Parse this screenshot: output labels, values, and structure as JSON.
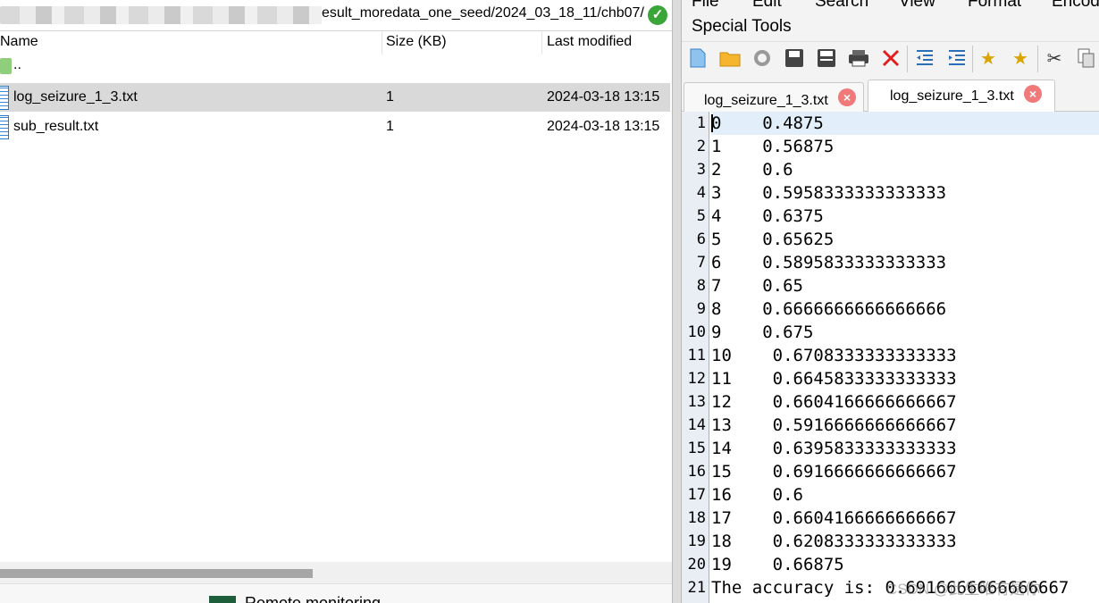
{
  "file_browser": {
    "path": "esult_moredata_one_seed/2024_03_18_11/chb07/",
    "columns": {
      "name": "Name",
      "size": "Size (KB)",
      "modified": "Last modified"
    },
    "parent_label": "..",
    "files": [
      {
        "name": "log_seizure_1_3.txt",
        "size": "1",
        "modified": "2024-03-18 13:15"
      },
      {
        "name": "sub_result.txt",
        "size": "1",
        "modified": "2024-03-18 13:15"
      }
    ],
    "status_text": "Remote monitoring",
    "colors": {
      "selected_row": "#d9d9d9",
      "ok": "#3aa63a"
    }
  },
  "editor": {
    "menu": [
      "File",
      "Edit",
      "Search",
      "View",
      "Format",
      "Encoding"
    ],
    "menu_second_row": "Special Tools",
    "toolbar_icons": [
      "new-file-icon",
      "open-folder-icon",
      "reload-icon",
      "save-icon",
      "save-all-icon",
      "print-icon",
      "close-icon",
      "outdent-icon",
      "indent-icon",
      "bookmark-icon",
      "bookmark-next-icon",
      "cut-icon",
      "copy-icon"
    ],
    "tabs": [
      {
        "label": "log_seizure_1_3.txt",
        "active": false
      },
      {
        "label": "log_seizure_1_3.txt",
        "active": true
      }
    ],
    "lines": [
      {
        "n": "1",
        "text": "0    0.4875"
      },
      {
        "n": "2",
        "text": "1    0.56875"
      },
      {
        "n": "3",
        "text": "2    0.6"
      },
      {
        "n": "4",
        "text": "3    0.5958333333333333"
      },
      {
        "n": "5",
        "text": "4    0.6375"
      },
      {
        "n": "6",
        "text": "5    0.65625"
      },
      {
        "n": "7",
        "text": "6    0.5895833333333333"
      },
      {
        "n": "8",
        "text": "7    0.65"
      },
      {
        "n": "9",
        "text": "8    0.6666666666666666"
      },
      {
        "n": "10",
        "text": "9    0.675"
      },
      {
        "n": "11",
        "text": "10    0.6708333333333333"
      },
      {
        "n": "12",
        "text": "11    0.6645833333333333"
      },
      {
        "n": "13",
        "text": "12    0.6604166666666667"
      },
      {
        "n": "14",
        "text": "13    0.5916666666666667"
      },
      {
        "n": "15",
        "text": "14    0.6395833333333333"
      },
      {
        "n": "16",
        "text": "15    0.6916666666666667"
      },
      {
        "n": "17",
        "text": "16    0.6"
      },
      {
        "n": "18",
        "text": "17    0.6604166666666667"
      },
      {
        "n": "19",
        "text": "18    0.6208333333333333"
      },
      {
        "n": "20",
        "text": "19    0.66875"
      },
      {
        "n": "21",
        "text": "The accuracy is: 0.6916666666666667"
      }
    ],
    "watermark": "CSDN @此生唯有是你",
    "colors": {
      "gutter": "#e9eef5",
      "current_line": "#e2effa",
      "tab_close": "#f07a7a"
    }
  }
}
